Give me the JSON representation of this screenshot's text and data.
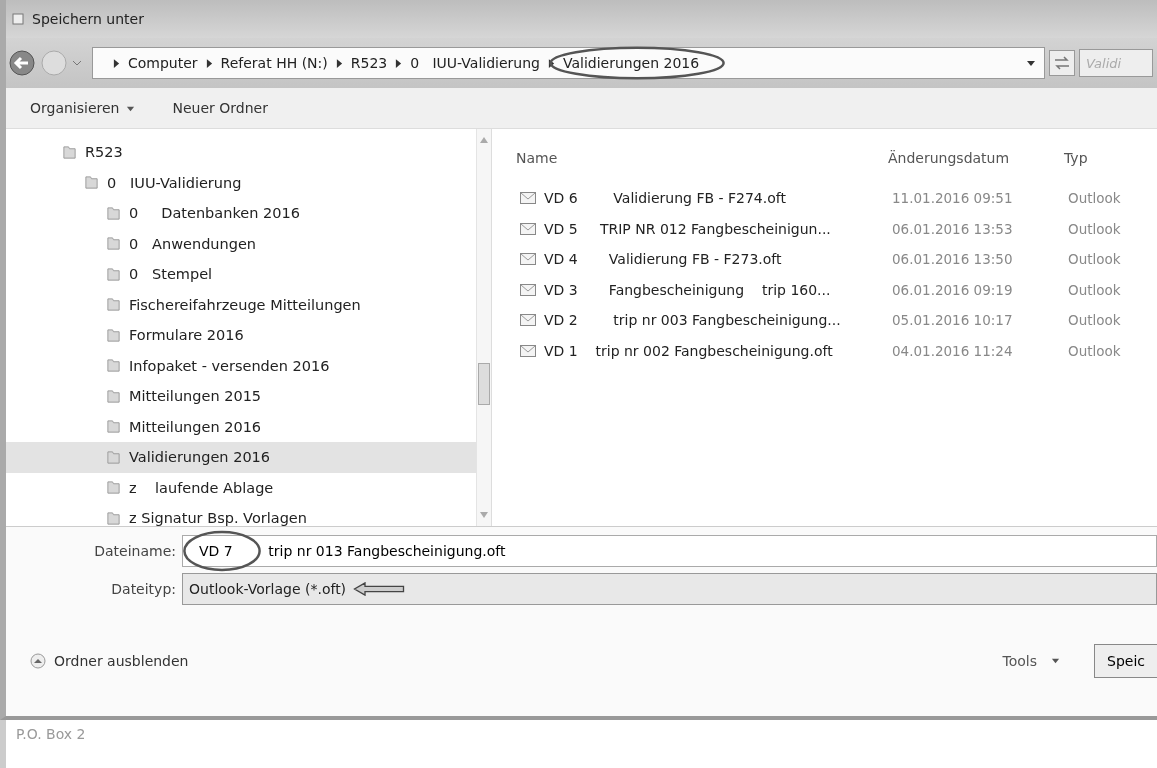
{
  "window": {
    "title": "Speichern unter"
  },
  "address_bar": {
    "crumbs": [
      {
        "label": "Computer",
        "circled": false
      },
      {
        "label": "Referat HH (N:)",
        "circled": false
      },
      {
        "label": "R523",
        "circled": false
      },
      {
        "label": "0   IUU-Validierung",
        "circled": false
      },
      {
        "label": "Validierungen 2016",
        "circled": true
      }
    ],
    "search": {
      "placeholder": "Validi"
    }
  },
  "toolbar": [
    {
      "label": "Organisieren",
      "dropdown": true
    },
    {
      "label": "Neuer Ordner",
      "dropdown": false
    }
  ],
  "tree": [
    {
      "label": "R523",
      "selected": false,
      "children": [
        {
          "label": "0   IUU-Validierung",
          "selected": false,
          "children": [
            {
              "label": "0     Datenbanken 2016",
              "selected": false
            },
            {
              "label": "0   Anwendungen",
              "selected": false
            },
            {
              "label": "0   Stempel",
              "selected": false
            },
            {
              "label": "Fischereifahrzeuge Mitteilungen",
              "selected": false
            },
            {
              "label": "Formulare 2016",
              "selected": false
            },
            {
              "label": "Infopaket - versenden 2016",
              "selected": false
            },
            {
              "label": "Mitteilungen 2015",
              "selected": false
            },
            {
              "label": "Mitteilungen 2016",
              "selected": false
            },
            {
              "label": "Validierungen 2016",
              "selected": true
            },
            {
              "label": "z    laufende Ablage",
              "selected": false
            },
            {
              "label": "z Signatur Bsp. Vorlagen",
              "selected": false
            }
          ]
        }
      ]
    }
  ],
  "table": {
    "columns": [
      "Name",
      "Änderungsdatum",
      "Typ"
    ],
    "rows": [
      {
        "name": "VD 6        Validierung FB - F274.oft",
        "date": "11.01.2016 09:51",
        "type": "Outlook"
      },
      {
        "name": "VD 5     TRIP NR 012 Fangbescheinigun...",
        "date": "06.01.2016 13:53",
        "type": "Outlook"
      },
      {
        "name": "VD 4       Validierung FB - F273.oft",
        "date": "06.01.2016 13:50",
        "type": "Outlook"
      },
      {
        "name": "VD 3       Fangbescheinigung    trip 160...",
        "date": "06.01.2016 09:19",
        "type": "Outlook"
      },
      {
        "name": "VD 2        trip nr 003 Fangbescheinigung...",
        "date": "05.01.2016 10:17",
        "type": "Outlook"
      },
      {
        "name": "VD 1    trip nr 002 Fangbescheinigung.oft",
        "date": "04.01.2016 11:24",
        "type": "Outlook"
      }
    ]
  },
  "filename": {
    "label": "Dateiname:",
    "value": "VD 7        trip nr 013 Fangbescheinigung.oft",
    "circled": true
  },
  "filetype": {
    "label": "Dateityp:",
    "value": "Outlook-Vorlage (*.oft)",
    "arrow_marked": true
  },
  "footer": {
    "hide_folders": "Ordner ausblenden",
    "tools": "Tools",
    "save": "Speic"
  },
  "below": {
    "text": "P.O. Box 2"
  }
}
